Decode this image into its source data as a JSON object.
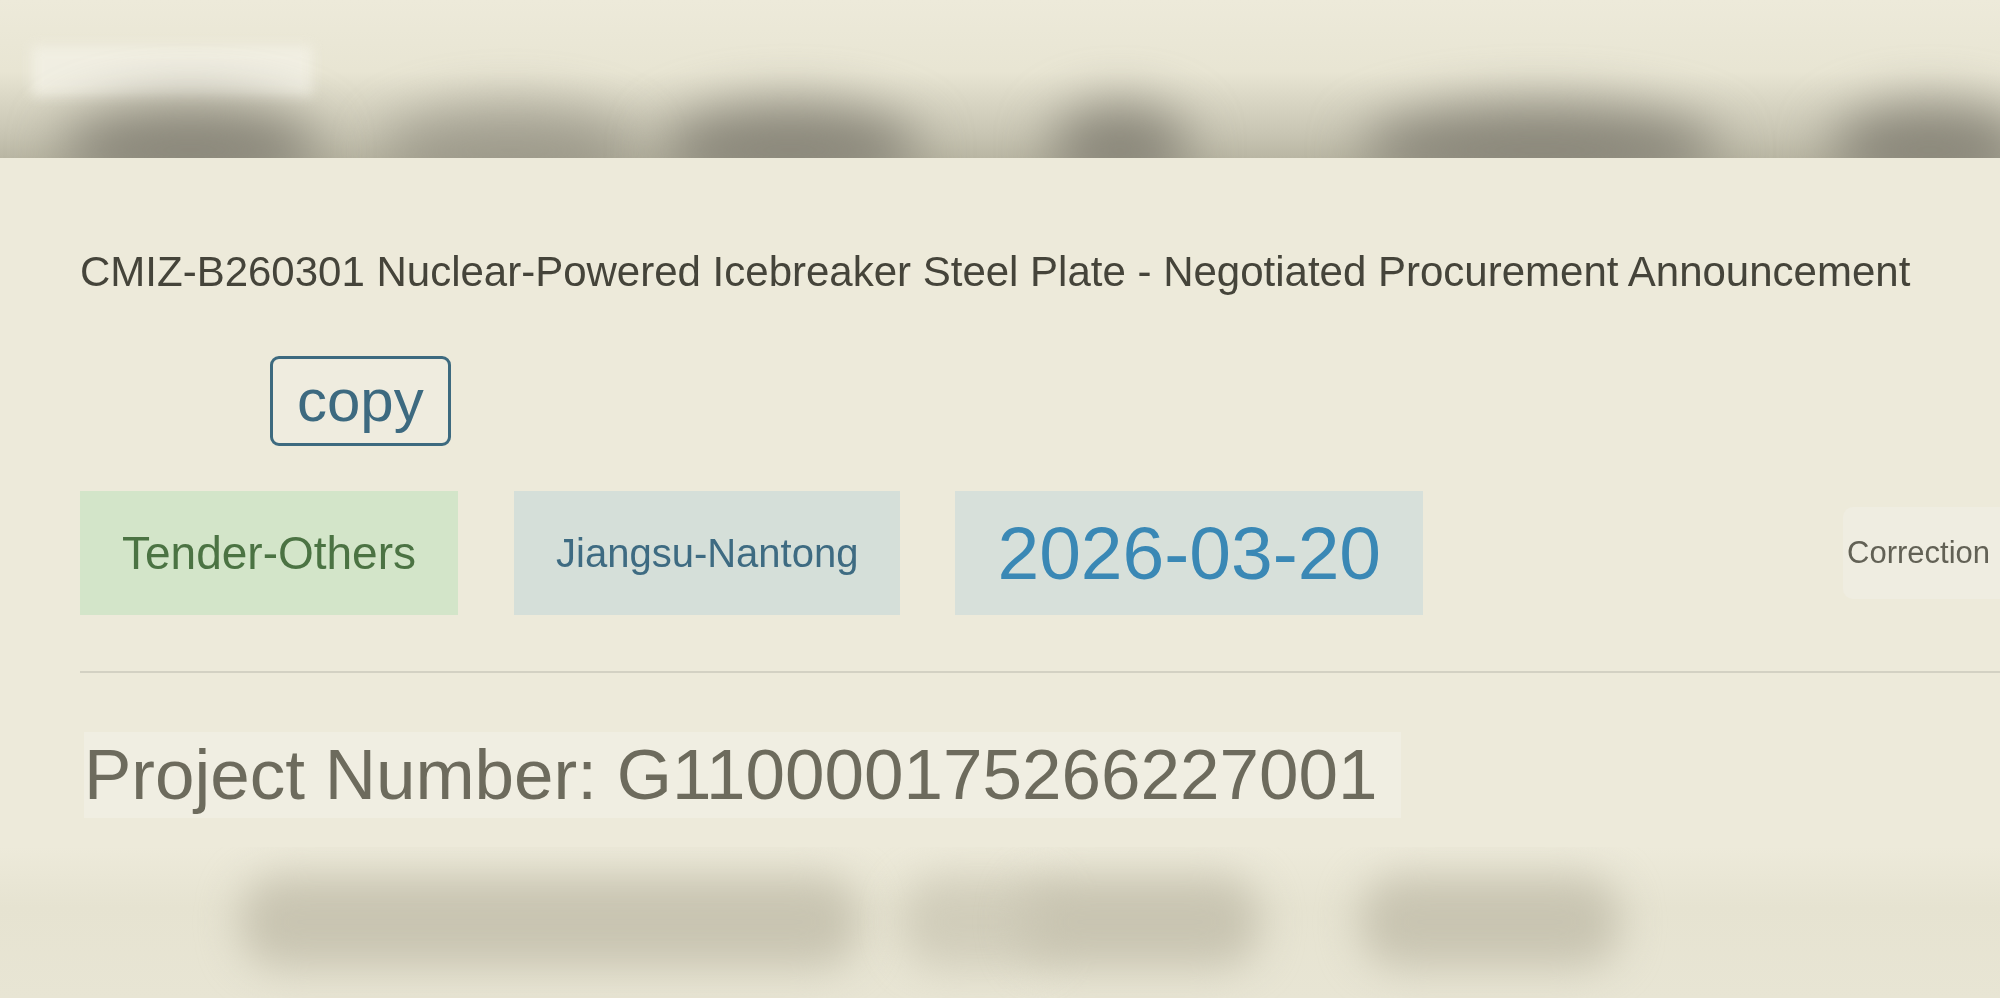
{
  "title": "CMIZ-B260301 Nuclear-Powered Icebreaker Steel Plate - Negotiated Procurement Announcement",
  "copy_button": {
    "label": "copy"
  },
  "tags": [
    {
      "kind": "category",
      "label": "Tender-Others"
    },
    {
      "kind": "region",
      "label": "Jiangsu-Nantong"
    },
    {
      "kind": "date",
      "label": "2026-03-20"
    }
  ],
  "correction_link": {
    "label": "Correction"
  },
  "project_number": "Project Number: G110000175266227001"
}
